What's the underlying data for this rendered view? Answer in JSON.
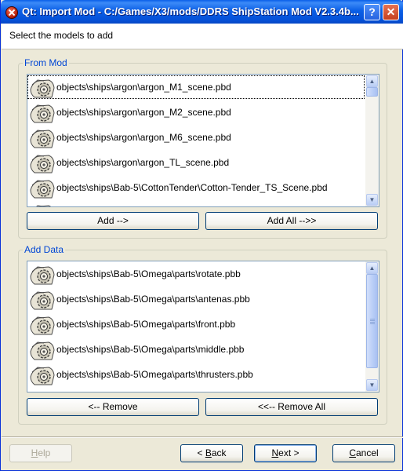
{
  "window": {
    "title": "Qt: Import Mod - C:/Games/X3/mods/DDRS ShipStation Mod V2.3.4b...",
    "help_glyph": "?",
    "close_glyph": "✕"
  },
  "header": {
    "text": "Select the models to add"
  },
  "from_mod": {
    "title": "From Mod",
    "items": [
      "objects\\ships\\argon\\argon_M1_scene.pbd",
      "objects\\ships\\argon\\argon_M2_scene.pbd",
      "objects\\ships\\argon\\argon_M6_scene.pbd",
      "objects\\ships\\argon\\argon_TL_scene.pbd",
      "objects\\ships\\Bab-5\\CottonTender\\Cotton-Tender_TS_Scene.pbd",
      ""
    ],
    "item_icon": "gear-model-icon",
    "add_button": "Add -->",
    "add_all_button": "Add All -->>"
  },
  "add_data": {
    "title": "Add Data",
    "items": [
      "objects\\ships\\Bab-5\\Omega\\parts\\rotate.pbb",
      "objects\\ships\\Bab-5\\Omega\\parts\\antenas.pbb",
      "objects\\ships\\Bab-5\\Omega\\parts\\front.pbb",
      "objects\\ships\\Bab-5\\Omega\\parts\\middle.pbb",
      "objects\\ships\\Bab-5\\Omega\\parts\\thrusters.pbb",
      ""
    ],
    "item_icon": "gear-model-icon",
    "remove_button": "<-- Remove",
    "remove_all_button": "<<-- Remove All"
  },
  "footer": {
    "help_first": "H",
    "help_rest": "elp",
    "back_prefix": "< ",
    "back_first": "B",
    "back_rest": "ack",
    "next_first": "N",
    "next_rest": "ext >",
    "cancel_first": "C",
    "cancel_rest": "ancel"
  },
  "colors": {
    "titlebar": "#0b5fe6",
    "group_title": "#0046d5",
    "window_bg": "#ece9d8"
  }
}
